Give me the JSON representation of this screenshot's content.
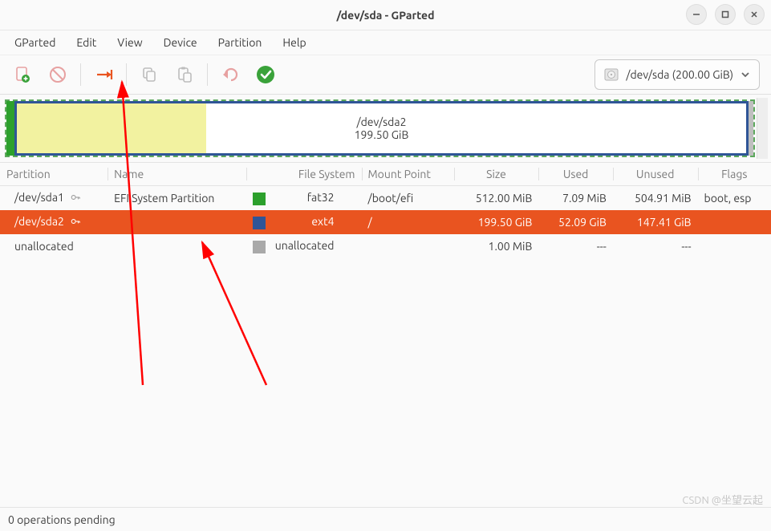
{
  "window": {
    "title": "/dev/sda - GParted"
  },
  "menubar": {
    "items": [
      "GParted",
      "Edit",
      "View",
      "Device",
      "Partition",
      "Help"
    ]
  },
  "toolbar": {
    "new_label": "New",
    "delete_label": "Delete",
    "resize_label": "Resize/Move",
    "copy_label": "Copy",
    "paste_label": "Paste",
    "undo_label": "Undo",
    "apply_label": "Apply"
  },
  "device_selector": {
    "label": "/dev/sda  (200.00 GiB)"
  },
  "graphic": {
    "partition_label": "/dev/sda2",
    "partition_size": "199.50 GiB"
  },
  "columns": {
    "partition": "Partition",
    "name": "Name",
    "filesystem": "File System",
    "mountpoint": "Mount Point",
    "size": "Size",
    "used": "Used",
    "unused": "Unused",
    "flags": "Flags"
  },
  "rows": [
    {
      "partition": "/dev/sda1",
      "locked": true,
      "name": "EFI System Partition",
      "fs": "fat32",
      "fs_color": "sw-fat32",
      "mount": "/boot/efi",
      "size": "512.00 MiB",
      "used": "7.09 MiB",
      "unused": "504.91 MiB",
      "flags": "boot, esp",
      "selected": false
    },
    {
      "partition": "/dev/sda2",
      "locked": true,
      "name": "",
      "fs": "ext4",
      "fs_color": "sw-ext4",
      "mount": "/",
      "size": "199.50 GiB",
      "used": "52.09 GiB",
      "unused": "147.41 GiB",
      "flags": "",
      "selected": true
    },
    {
      "partition": "unallocated",
      "locked": false,
      "name": "",
      "fs": "unallocated",
      "fs_color": "sw-unalloc",
      "mount": "",
      "size": "1.00 MiB",
      "used": "---",
      "unused": "---",
      "flags": "",
      "selected": false
    }
  ],
  "statusbar": {
    "text": "0 operations pending"
  },
  "watermark": "CSDN @坐望云起"
}
